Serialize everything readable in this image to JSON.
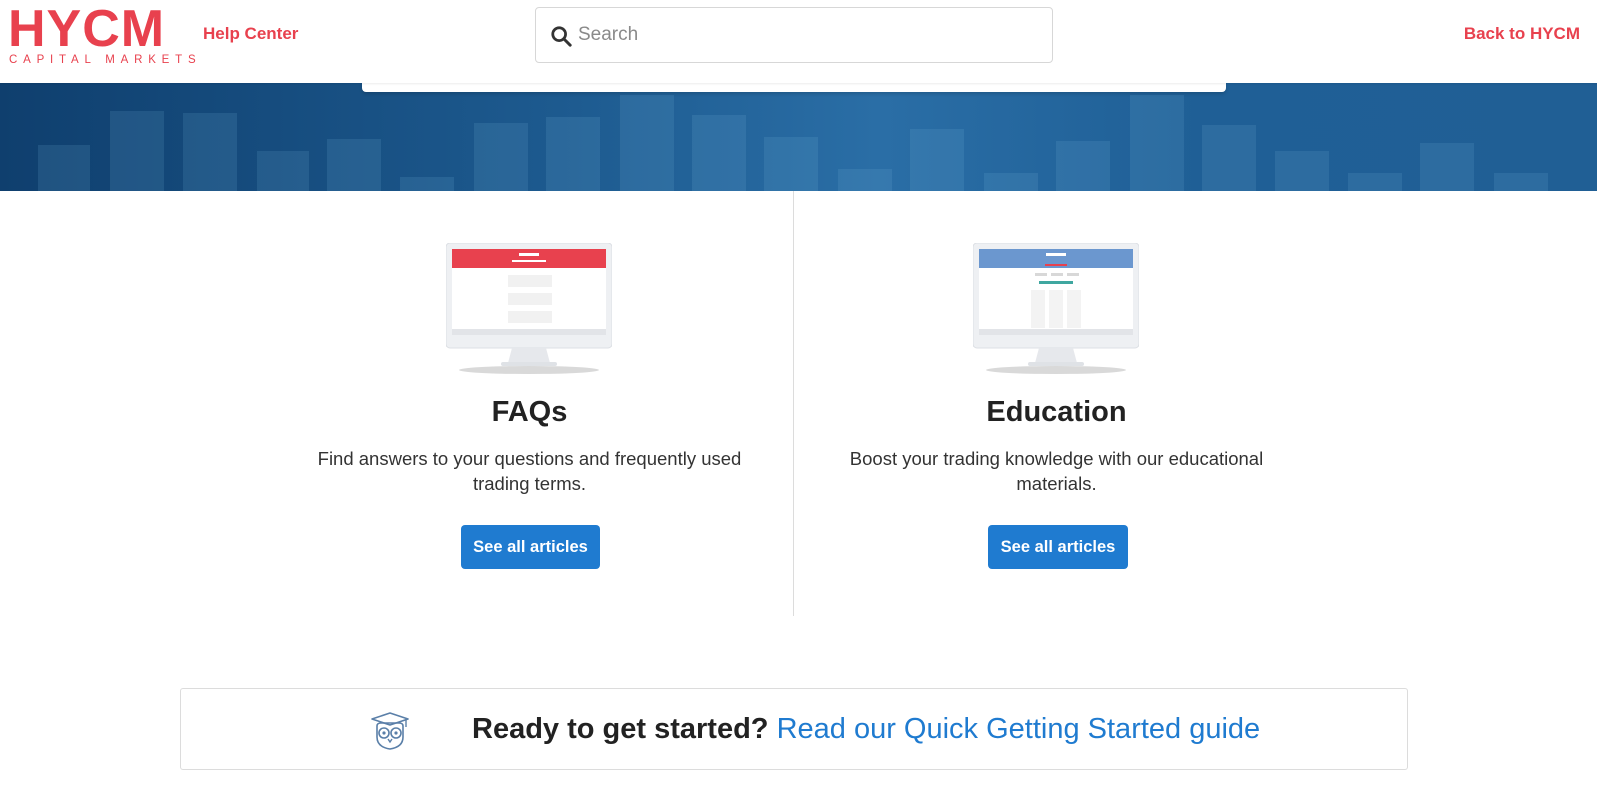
{
  "header": {
    "logo_text": "HYCM",
    "logo_subtitle": "CAPITAL MARKETS",
    "help_center": "Help Center",
    "search_placeholder": "Search",
    "back_link": "Back to HYCM"
  },
  "categories": [
    {
      "title": "FAQs",
      "description": "Find answers to your questions and frequently used trading terms.",
      "button": "See all articles",
      "screen_color": "#e8414e"
    },
    {
      "title": "Education",
      "description": "Boost your trading knowledge with our educational materials.",
      "button": "See all articles",
      "screen_color": "#6b97cf"
    }
  ],
  "getting_started": {
    "lead": "Ready to get started?",
    "link": "Read our Quick Getting Started guide"
  },
  "colors": {
    "brand_red": "#e8414e",
    "button_blue": "#1f7bd0",
    "link_blue": "#1f7bd0"
  }
}
